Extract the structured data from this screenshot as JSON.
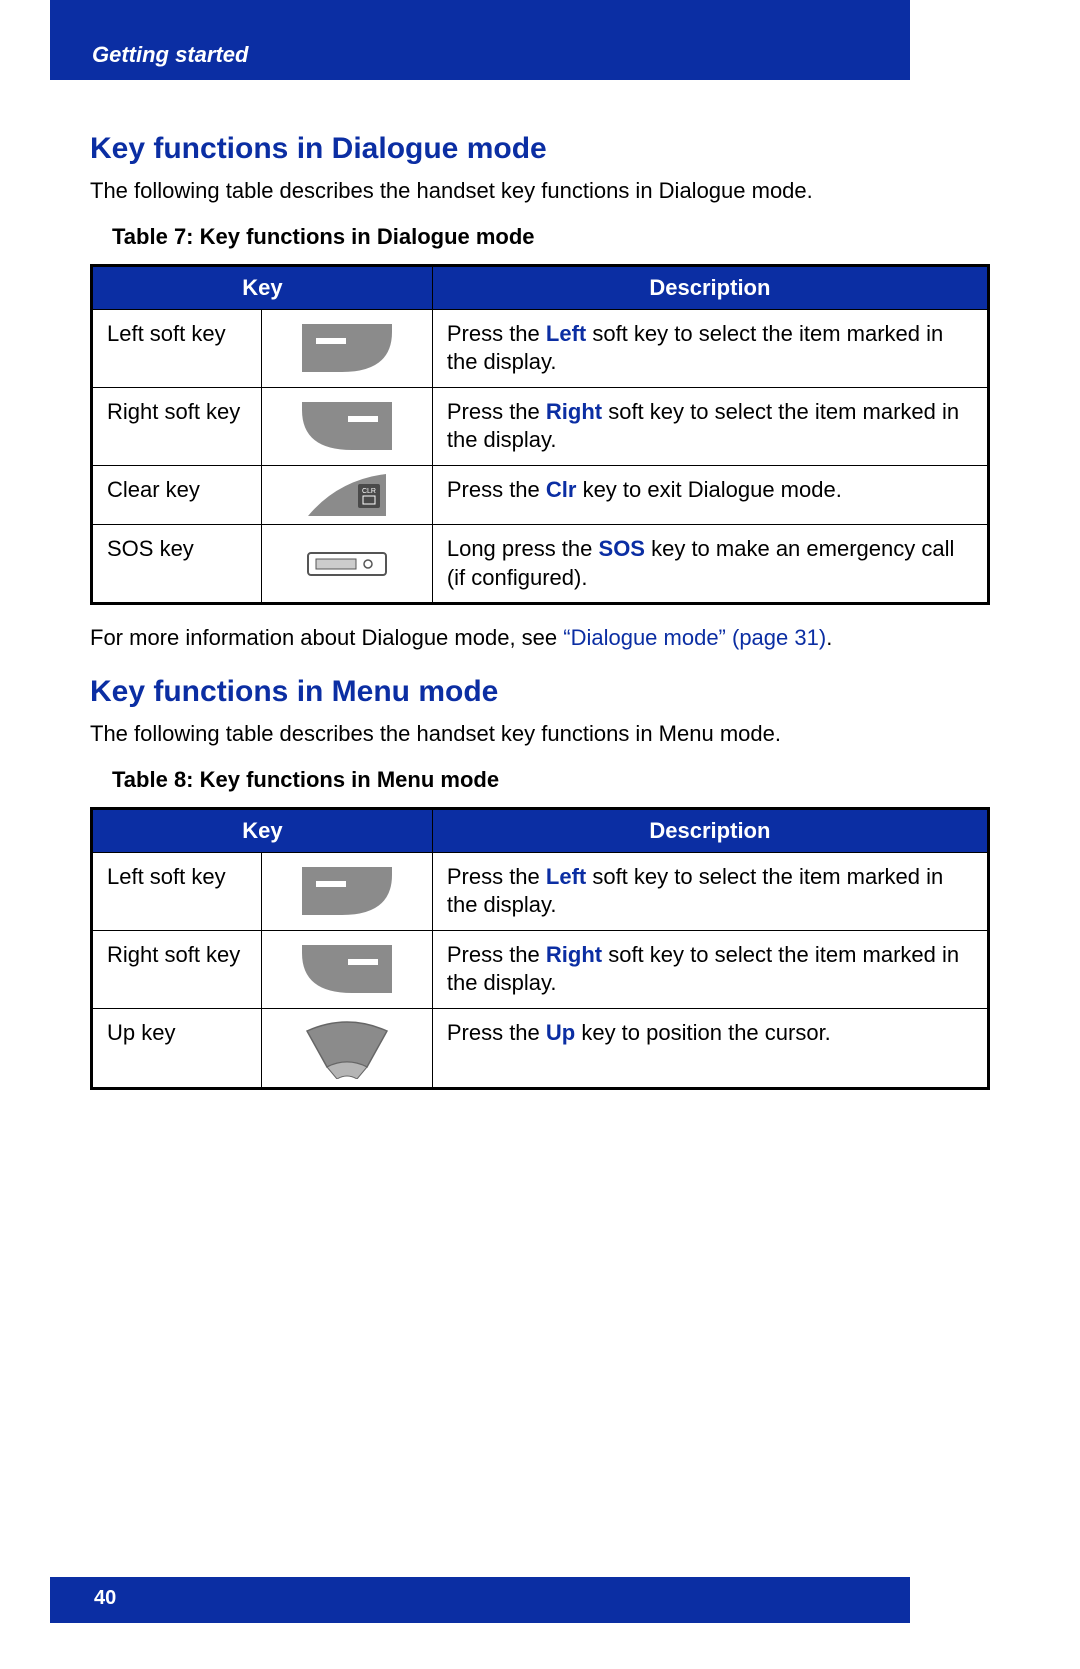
{
  "header": {
    "section_label": "Getting started"
  },
  "section1": {
    "title": "Key functions in Dialogue mode",
    "intro": "The following table describes the handset key functions in Dialogue mode.",
    "table_caption": "Table 7: Key functions in Dialogue mode",
    "col_key": "Key",
    "col_desc": "Description",
    "rows": [
      {
        "name": "Left soft key",
        "desc_pre": "Press the ",
        "desc_bold": "Left",
        "desc_post": " soft key to select the item marked in the display."
      },
      {
        "name": "Right soft key",
        "desc_pre": "Press the ",
        "desc_bold": "Right",
        "desc_post": " soft key to select the item marked in the display."
      },
      {
        "name": "Clear key",
        "desc_pre": "Press the ",
        "desc_bold": "Clr",
        "desc_post": " key to exit Dialogue mode."
      },
      {
        "name": "SOS key",
        "desc_pre": "Long press the ",
        "desc_bold": "SOS",
        "desc_post": " key to make an emergency call (if configured)."
      }
    ],
    "after_pre": "For more information about Dialogue mode, see ",
    "after_link": "“Dialogue mode” (page 31)",
    "after_post": "."
  },
  "section2": {
    "title": "Key functions in Menu mode",
    "intro": "The following table describes the handset key functions in Menu mode.",
    "table_caption": "Table 8: Key functions in Menu mode",
    "col_key": "Key",
    "col_desc": "Description",
    "rows": [
      {
        "name": "Left soft key",
        "desc_pre": "Press the ",
        "desc_bold": "Left",
        "desc_post": " soft key to select the item marked in the display."
      },
      {
        "name": "Right soft key",
        "desc_pre": "Press the ",
        "desc_bold": "Right",
        "desc_post": " soft key to select the item marked in the display."
      },
      {
        "name": "Up key",
        "desc_pre": "Press the ",
        "desc_bold": "Up",
        "desc_post": " key to position the cursor."
      }
    ]
  },
  "footer": {
    "page_number": "40"
  }
}
